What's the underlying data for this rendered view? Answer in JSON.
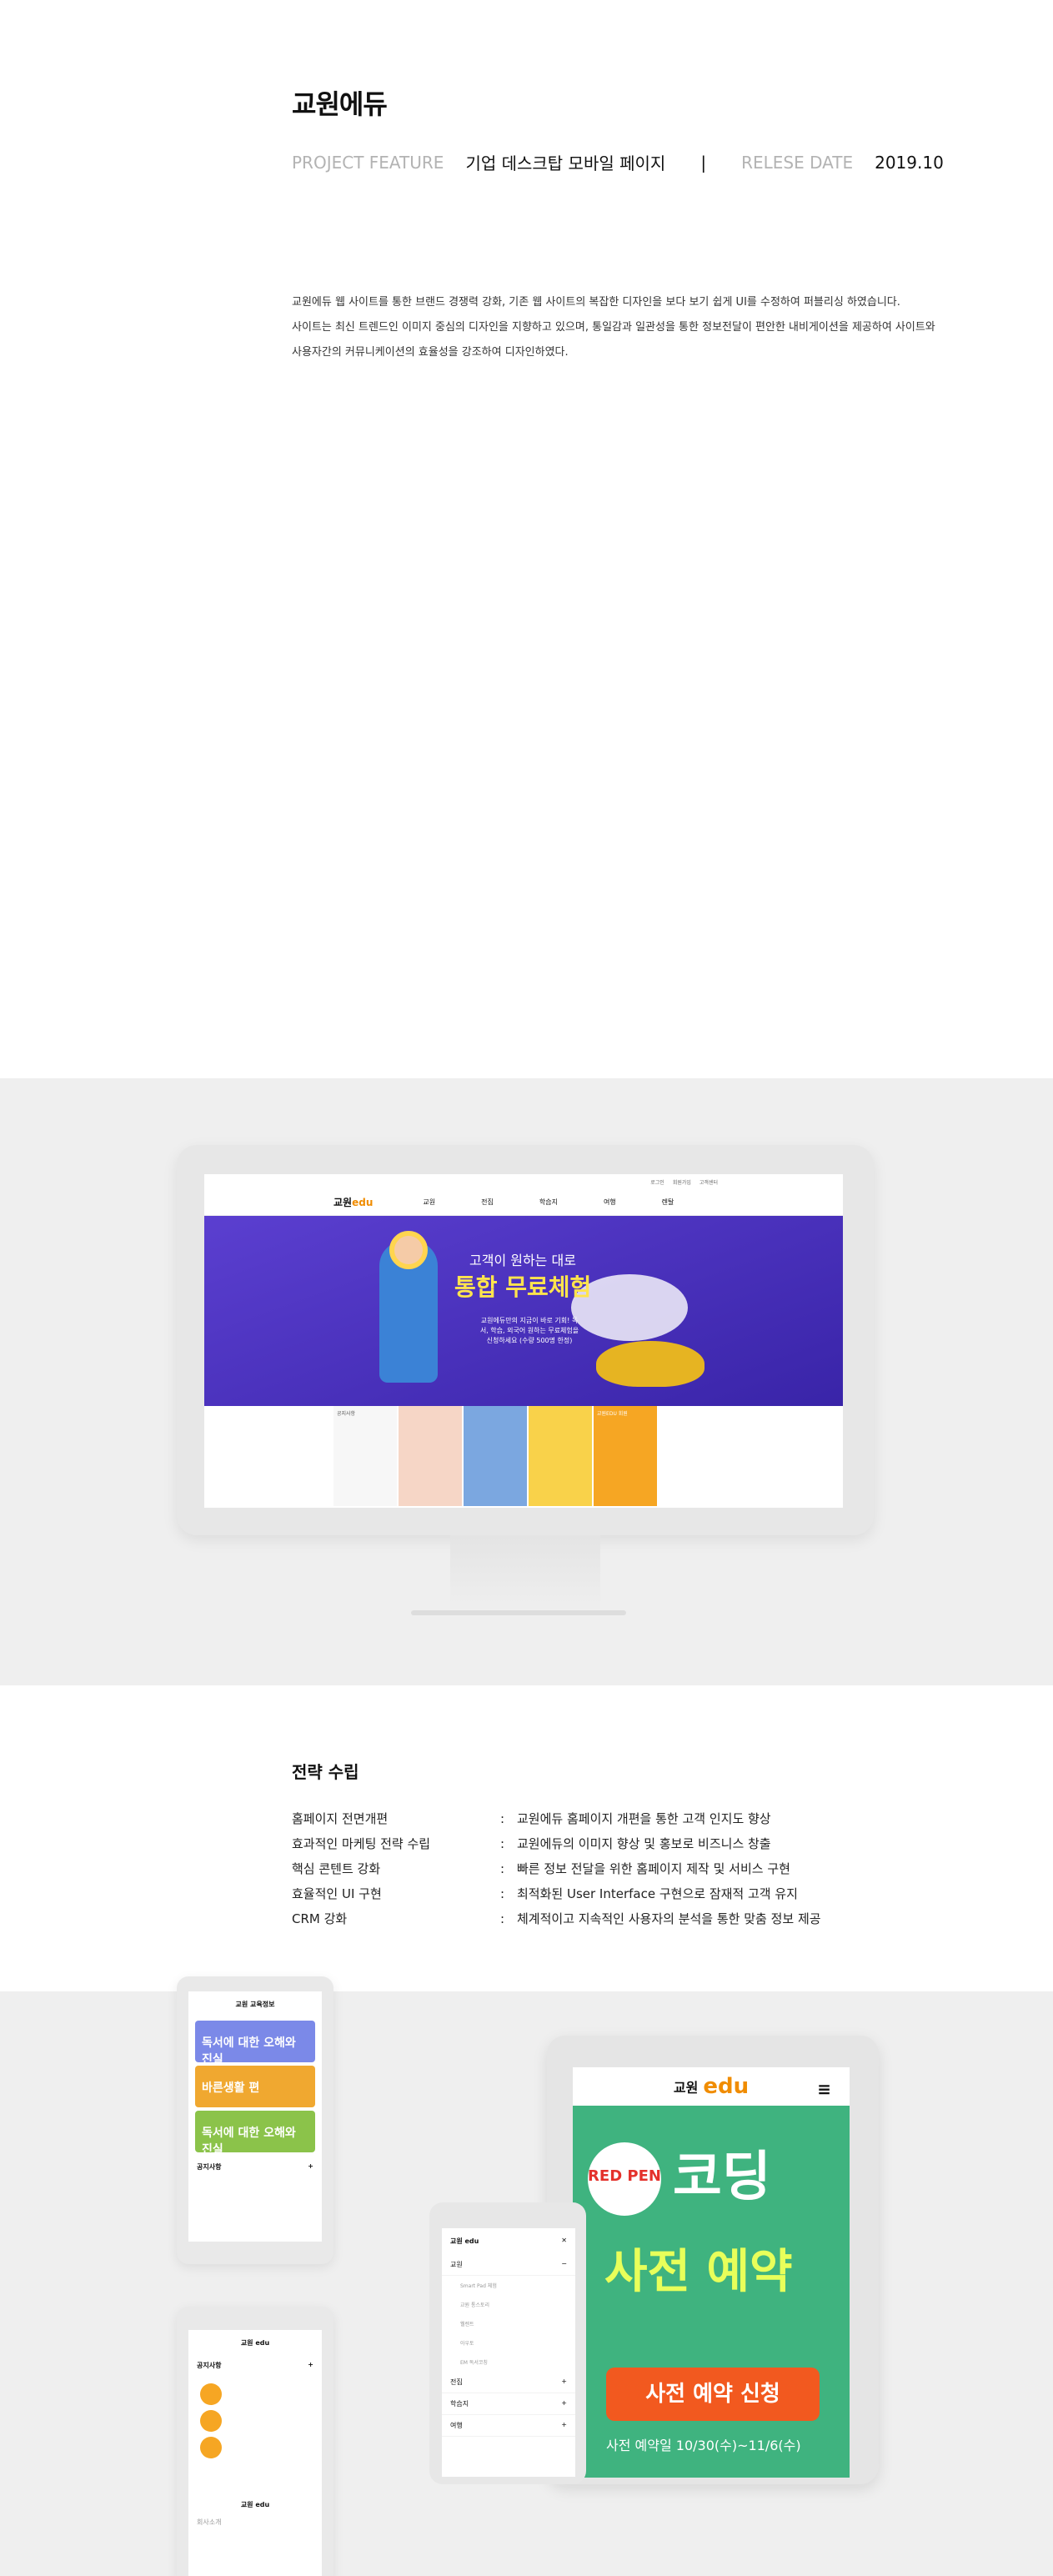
{
  "project": {
    "title": "교원에듀",
    "feature_label": "PROJECT FEATURE",
    "feature_value": "기업 데스크탑 모바일 페이지",
    "separator": "|",
    "date_label": "RELESE DATE",
    "date_value": "2019.10",
    "description": [
      "교원에듀 웹 사이트를 통한 브랜드 경쟁력 강화, 기존 웹 사이트의 복잡한 디자인을 보다 보기 쉽게 UI를 수정하여 퍼블리싱 하였습니다.",
      "사이트는 최신 트렌드인 이미지 중심의 디자인을 지향하고 있으며, 통일감과 일관성을 통한 정보전달이 편안한 내비게이션을 제공하여 사이트와",
      "사용자간의 커뮤니케이션의 효율성을 강조하여 디자인하였다."
    ]
  },
  "desktop": {
    "topbar": [
      "로그인",
      "회원가입",
      "고객센터"
    ],
    "logo_text": "교원",
    "logo_accent": "edu",
    "menu": [
      "교원",
      "전집",
      "학습지",
      "여행",
      "렌탈"
    ],
    "hero_line1": "고객이 원하는 대로",
    "hero_line2": "통합 무료체험",
    "hero_sub": "교원에듀만의 지금이 바로 기회! 독서, 학습, 외국어 원하는 무료체험을 신청하세요 (수량 500명 한정)",
    "cards": [
      "공지사항",
      "",
      "",
      "",
      "교원EDU 회원"
    ]
  },
  "strategy": {
    "title": "전략 수립",
    "rows": [
      {
        "key": "홈페이지 전면개편",
        "value": "교원에듀 홈페이지 개편을 통한 고객 인지도 향상"
      },
      {
        "key": "효과적인 마케팅 전략 수립",
        "value": "교원에듀의 이미지 향상 및 홍보로 비즈니스 창출"
      },
      {
        "key": "핵심 콘텐트 강화",
        "value": "빠른 정보 전달을 위한 홈페이지 제작 및 서비스 구현"
      },
      {
        "key": "효율적인 UI 구현",
        "value": "최적화된 User Interface 구현으로 잠재적 고객 유지"
      },
      {
        "key": "CRM 강화",
        "value": "체계적이고 지속적인 사용자의 분석을 통한 맞춤 정보 제공"
      }
    ],
    "colon": ":"
  },
  "mobile_left": {
    "header": "교원 교육정보",
    "banners": [
      "독서에 대한 오해와 진실",
      "바른생활 편",
      "독서에 대한 오해와 진실"
    ],
    "notice": "공지사항",
    "plus": "+"
  },
  "mobile_left2": {
    "logo": "교원 edu",
    "notice": "공지사항",
    "plus": "+",
    "footer_logo": "교원 edu",
    "footer_text": "회사소개"
  },
  "mobile_menu": {
    "logo": "교원 edu",
    "close": "✕",
    "items": [
      {
        "label": "교원",
        "sign": "−"
      },
      {
        "label": "전집",
        "sign": "+"
      },
      {
        "label": "학습지",
        "sign": "+"
      },
      {
        "label": "여행",
        "sign": "+"
      }
    ],
    "subitems": [
      "Smart Pad 체험",
      "교원 통스토리",
      "웰렌트",
      "아우토",
      "EM 독서코칭"
    ]
  },
  "tablet": {
    "logo_text": "교원",
    "logo_accent": "edu",
    "menu_icon": "≡",
    "badge": "RED PEN",
    "headline1": "코딩",
    "headline2": "사전 예약",
    "button": "사전 예약 신청",
    "date": "사전 예약일 10/30(수)~11/6(수)"
  }
}
